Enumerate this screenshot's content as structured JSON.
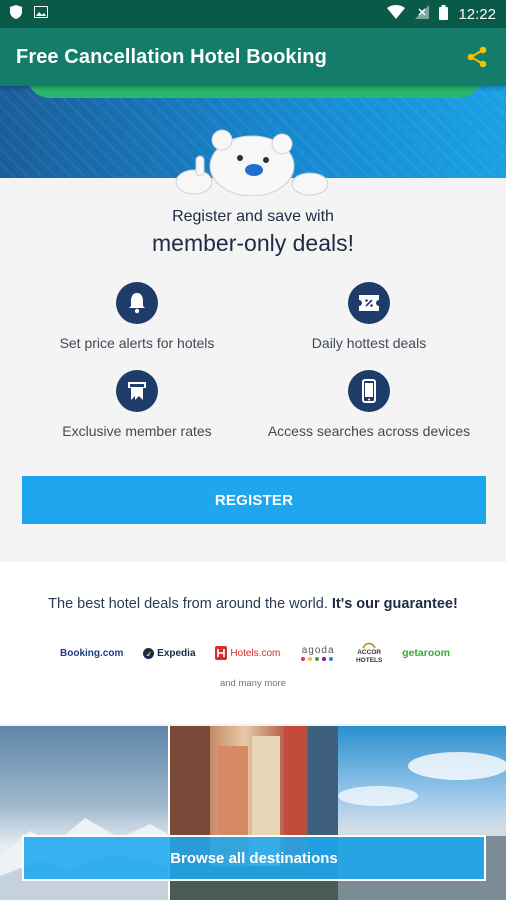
{
  "status_bar": {
    "time": "12:22"
  },
  "app_bar": {
    "title": "Free Cancellation Hotel Booking"
  },
  "member": {
    "lead": "Register and save with",
    "headline": "member-only deals!",
    "features": [
      {
        "label": "Set price alerts for hotels",
        "icon": "bell-icon"
      },
      {
        "label": "Daily hottest deals",
        "icon": "discount-icon"
      },
      {
        "label": "Exclusive member rates",
        "icon": "member-badge-icon"
      },
      {
        "label": "Access searches across devices",
        "icon": "phone-icon"
      }
    ],
    "register_label": "REGISTER"
  },
  "partners": {
    "tagline_normal": "The best hotel deals from around the world. ",
    "tagline_bold": "It's our guarantee!",
    "logos": {
      "booking": "Booking.com",
      "expedia": "Expedia",
      "hotels": "Hotels.com",
      "agoda": "agoda",
      "accor_line1": "ACCOR",
      "accor_line2": "HOTELS",
      "getaroom": "getaroom"
    },
    "more": "and many more"
  },
  "browse_label": "Browse all destinations",
  "colors": {
    "status_bar": "#0a5a4a",
    "app_bar": "#137c6b",
    "accent": "#1ea7ee",
    "icon_circle": "#1f3b69",
    "headline": "#1f2a44"
  }
}
